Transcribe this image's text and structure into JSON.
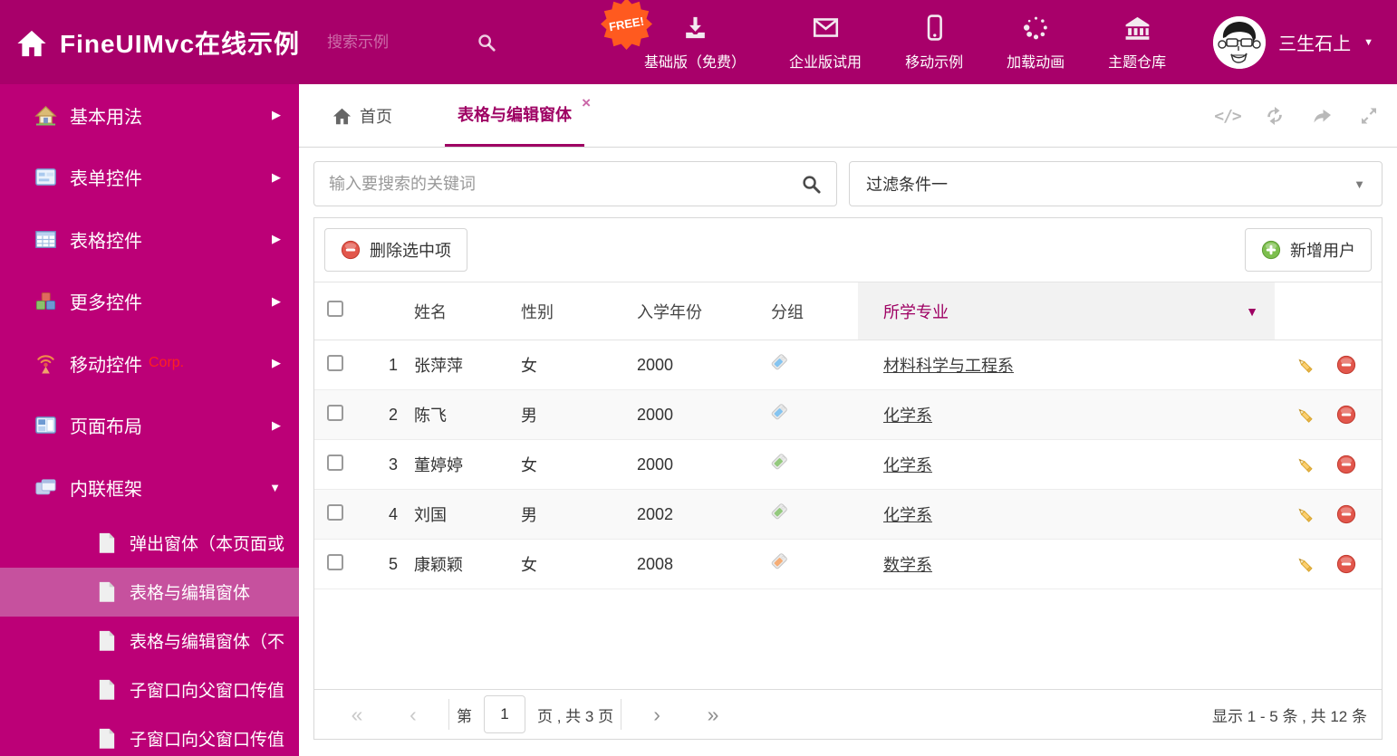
{
  "theme": {
    "header_bg": "#A8006A",
    "sidebar_bg": "#BC0077",
    "sidebar_active_bg": "#C6519E",
    "accent": "#9E0063",
    "corp_red": "#FF2020",
    "free_badge_bg": "#FF5A1F",
    "link_color": "#3D3D3D",
    "tag_colors": {
      "blue": "#85C4F0",
      "green": "#94C97E",
      "orange": "#F5AD76"
    }
  },
  "header": {
    "brand_title": "FineUIMvc在线示例",
    "search_placeholder": "搜索示例",
    "items": [
      {
        "label": "基础版（免费）",
        "icon": "download",
        "name": "download-icon",
        "badge": "FREE!"
      },
      {
        "label": "企业版试用",
        "icon": "mail",
        "name": "mail-icon"
      },
      {
        "label": "移动示例",
        "icon": "mobile",
        "name": "mobile-icon"
      },
      {
        "label": "加载动画",
        "icon": "spinner",
        "name": "spinner-icon"
      },
      {
        "label": "主题仓库",
        "icon": "bank",
        "name": "bank-icon"
      }
    ],
    "user_name": "三生石上"
  },
  "sidebar": {
    "items": [
      {
        "label": "基本用法",
        "icon": "home",
        "name": "home-icon"
      },
      {
        "label": "表单控件",
        "icon": "form",
        "name": "form-icon"
      },
      {
        "label": "表格控件",
        "icon": "table",
        "name": "table-icon"
      },
      {
        "label": "更多控件",
        "icon": "cubes",
        "name": "cubes-icon"
      },
      {
        "label": "移动控件",
        "suffix": "Corp.",
        "icon": "antenna",
        "name": "antenna-icon"
      },
      {
        "label": "页面布局",
        "icon": "layout",
        "name": "layout-icon"
      },
      {
        "label": "内联框架",
        "icon": "frames",
        "name": "frames-icon",
        "expanded": true
      }
    ],
    "subitems": [
      {
        "label": "弹出窗体（本页面或..."
      },
      {
        "label": "表格与编辑窗体",
        "active": true
      },
      {
        "label": "表格与编辑窗体（不..."
      },
      {
        "label": "子窗口向父窗口传值"
      },
      {
        "label": "子窗口向父窗口传值..."
      }
    ]
  },
  "tabs": [
    {
      "label": "首页",
      "icon": "home_gray"
    },
    {
      "label": "表格与编辑窗体",
      "active": true,
      "closable": true
    }
  ],
  "tab_toolbar": [
    {
      "icon": "code",
      "name": "source-code-icon"
    },
    {
      "icon": "refresh",
      "name": "refresh-icon"
    },
    {
      "icon": "forward",
      "name": "share-icon"
    },
    {
      "icon": "expand",
      "name": "fullscreen-icon"
    }
  ],
  "filters": {
    "search_placeholder": "输入要搜索的关键词",
    "dropdown_value": "过滤条件一"
  },
  "grid": {
    "delete_label": "删除选中项",
    "add_label": "新增用户",
    "columns": {
      "name": "姓名",
      "gender": "性别",
      "year": "入学年份",
      "group": "分组",
      "major": "所学专业"
    },
    "rows": [
      {
        "num": "1",
        "name": "张萍萍",
        "gender": "女",
        "year": "2000",
        "tag": "blue",
        "major": "材料科学与工程系"
      },
      {
        "num": "2",
        "name": "陈飞",
        "gender": "男",
        "year": "2000",
        "tag": "blue",
        "major": "化学系"
      },
      {
        "num": "3",
        "name": "董婷婷",
        "gender": "女",
        "year": "2000",
        "tag": "green",
        "major": "化学系"
      },
      {
        "num": "4",
        "name": "刘国",
        "gender": "男",
        "year": "2002",
        "tag": "green",
        "major": "化学系"
      },
      {
        "num": "5",
        "name": "康颖颖",
        "gender": "女",
        "year": "2008",
        "tag": "orange",
        "major": "数学系"
      }
    ],
    "pagination": {
      "page_prefix": "第",
      "page_value": "1",
      "page_suffix": "页 , 共 3 页",
      "summary": "显示 1 - 5 条 , 共 12 条"
    }
  }
}
